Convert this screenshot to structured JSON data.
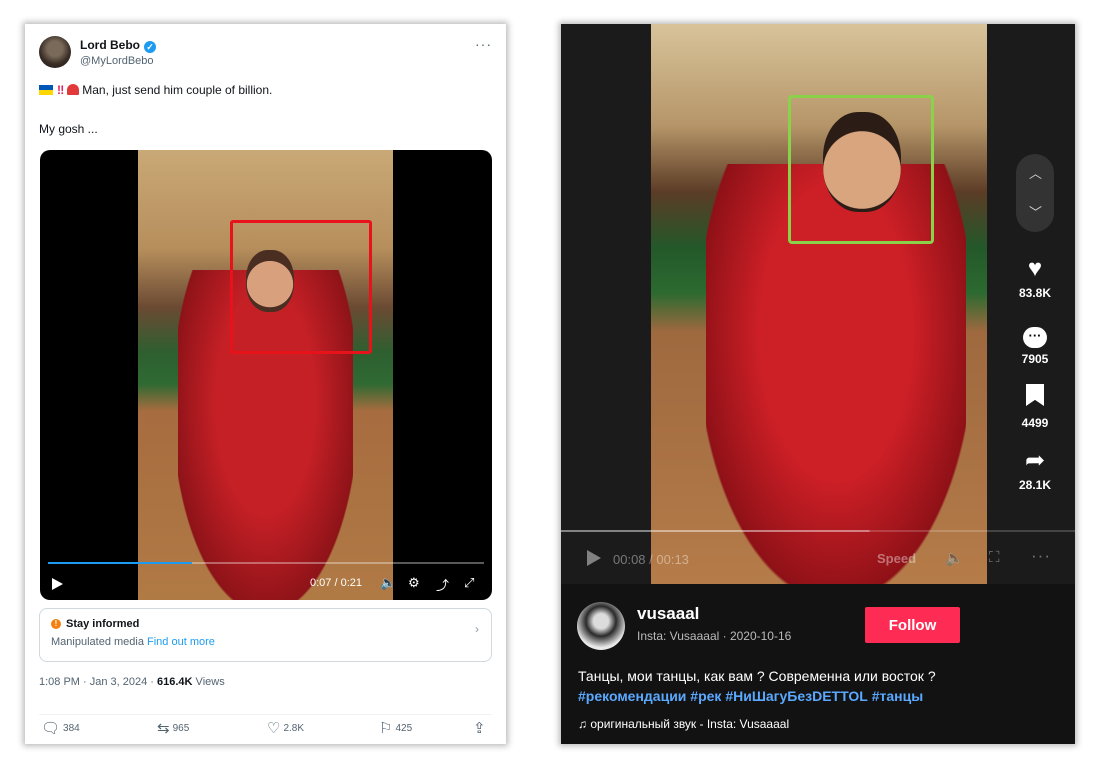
{
  "tweet": {
    "author_name": "Lord Bebo",
    "author_handle": "@MyLordBebo",
    "more": "···",
    "line1_text": "Man, just send him couple of billion.",
    "line2_text": "My gosh ...",
    "video": {
      "time": "0:07 / 0:21",
      "progress_fraction": 0.33
    },
    "notice": {
      "title": "Stay informed",
      "body": "Manipulated media",
      "link": "Find out more"
    },
    "meta": {
      "datetime": "1:08 PM · Jan 3, 2024 · ",
      "views_count": "616.4K",
      "views_label": " Views"
    },
    "actions": {
      "replies": "384",
      "reposts": "965",
      "likes": "2.8K",
      "bookmarks": "425"
    }
  },
  "tiktok": {
    "stats": {
      "likes": "83.8K",
      "comments": "7905",
      "saves": "4499",
      "shares": "28.1K"
    },
    "controls": {
      "time": "00:08 / 00:13",
      "speed": "Speed",
      "progress_fraction": 0.6
    },
    "username": "vusaaal",
    "subline": "Insta: Vusaaaal · 2020-10-16",
    "follow_label": "Follow",
    "caption_text": "Танцы, мои танцы, как вам ? Современна или восток ?",
    "hashtags": [
      "#рекомендации",
      "#рек",
      "#НиШагуБезDETTOL",
      "#танцы"
    ],
    "sound": "оригинальный звук - Insta: Vusaaaal"
  },
  "colors": {
    "highlight_left": "#e8121b",
    "highlight_right": "#8bd24b",
    "follow_button": "#fe2c55",
    "twitter_blue": "#1d9bf0"
  }
}
